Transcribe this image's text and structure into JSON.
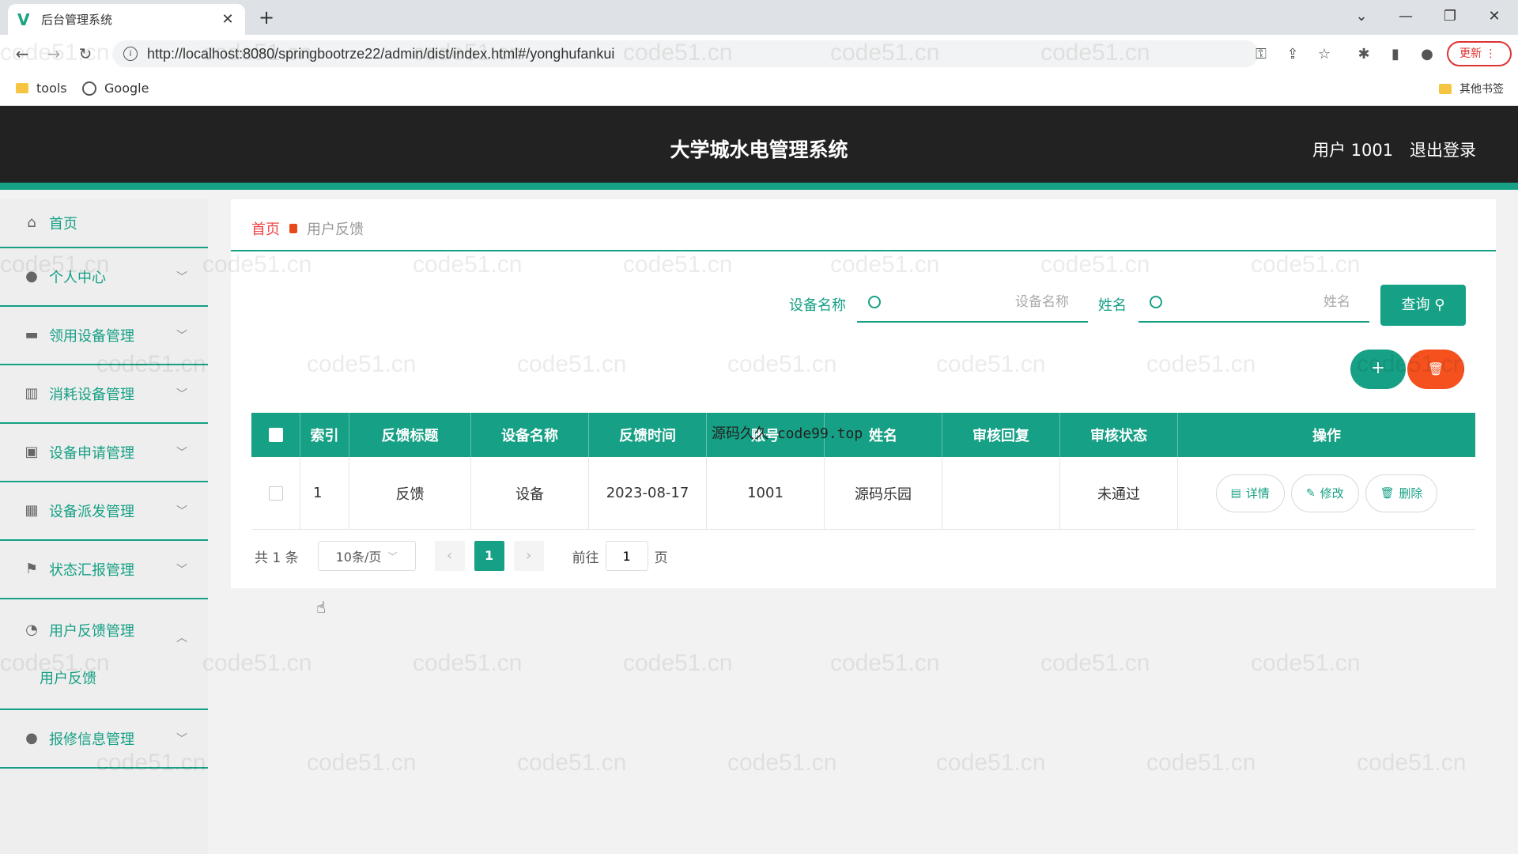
{
  "browser": {
    "tab_title": "后台管理系统",
    "url": "http://localhost:8080/springbootrze22/admin/dist/index.html#/yonghufankui",
    "update_label": "更新",
    "bookmarks": [
      "tools",
      "Google"
    ],
    "other_bookmarks": "其他书签"
  },
  "header": {
    "title": "大学城水电管理系统",
    "user": "用户 1001",
    "logout": "退出登录"
  },
  "sidebar": {
    "items": [
      {
        "label": "首页"
      },
      {
        "label": "个人中心"
      },
      {
        "label": "领用设备管理"
      },
      {
        "label": "消耗设备管理"
      },
      {
        "label": "设备申请管理"
      },
      {
        "label": "设备派发管理"
      },
      {
        "label": "状态汇报管理"
      },
      {
        "label": "用户反馈管理",
        "sub": "用户反馈"
      },
      {
        "label": "报修信息管理"
      }
    ]
  },
  "breadcrumb": {
    "home": "首页",
    "current": "用户反馈"
  },
  "search": {
    "device_label": "设备名称",
    "device_placeholder": "设备名称",
    "name_label": "姓名",
    "name_placeholder": "姓名",
    "query_label": "查询"
  },
  "table": {
    "headers": [
      "索引",
      "反馈标题",
      "设备名称",
      "反馈时间",
      "账号",
      "姓名",
      "审核回复",
      "审核状态",
      "操作"
    ],
    "rows": [
      {
        "index": "1",
        "title": "反馈",
        "device": "设备",
        "time": "2023-08-17",
        "account": "1001",
        "name": "源码乐园",
        "reply": "",
        "status": "未通过"
      }
    ],
    "actions": {
      "detail": "详情",
      "edit": "修改",
      "delete": "删除"
    },
    "overlay_text": "源码久久 code99.top"
  },
  "pagination": {
    "total": "共 1 条",
    "page_size": "10条/页",
    "current_page": "1",
    "goto_label": "前往",
    "goto_value": "1",
    "page_suffix": "页"
  },
  "watermark": "code51.cn",
  "colors": {
    "accent": "#16a085",
    "danger": "#f4511e",
    "header_bg": "#222222"
  }
}
